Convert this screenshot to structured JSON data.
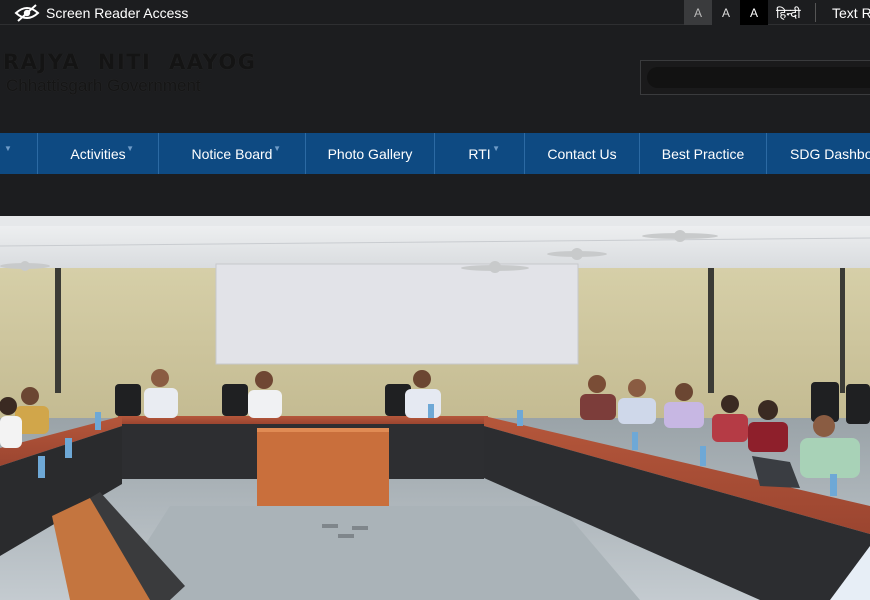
{
  "topbar": {
    "screen_reader_label": "Screen Reader Access",
    "font_sizes": [
      "A",
      "A",
      "A"
    ],
    "language": "हिन्दी",
    "text_resize_label": "Text R"
  },
  "header": {
    "org_name": "RAJYA  NITI  AAYOG",
    "org_sub": "Chhattisgarh Government",
    "search_placeholder": ""
  },
  "nav": {
    "items": [
      {
        "label": ""
      },
      {
        "label": "Activities"
      },
      {
        "label": "Notice Board"
      },
      {
        "label": "Photo Gallery"
      },
      {
        "label": "RTI"
      },
      {
        "label": "Contact Us"
      },
      {
        "label": "Best Practice"
      },
      {
        "label": "SDG Dashbo"
      }
    ]
  },
  "hero": {
    "image_alt": ""
  },
  "colors": {
    "page_bg": "#1c1d1f",
    "nav_bg": "#0e4a82",
    "nav_divider": "#2c6aa3"
  }
}
